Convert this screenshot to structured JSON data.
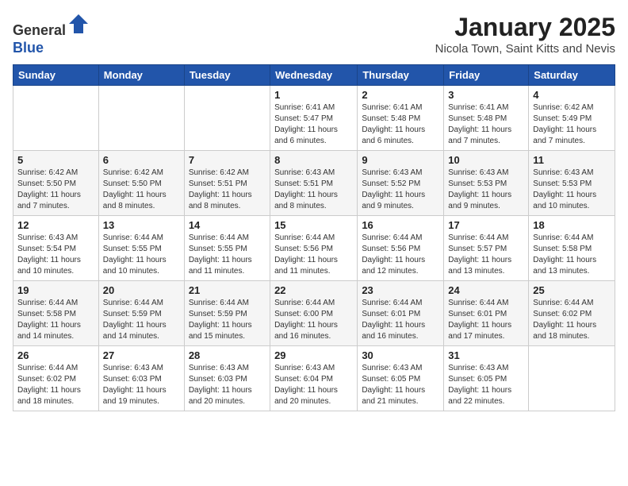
{
  "header": {
    "logo_line1": "General",
    "logo_line2": "Blue",
    "month": "January 2025",
    "location": "Nicola Town, Saint Kitts and Nevis"
  },
  "weekdays": [
    "Sunday",
    "Monday",
    "Tuesday",
    "Wednesday",
    "Thursday",
    "Friday",
    "Saturday"
  ],
  "weeks": [
    [
      {
        "day": "",
        "info": ""
      },
      {
        "day": "",
        "info": ""
      },
      {
        "day": "",
        "info": ""
      },
      {
        "day": "1",
        "info": "Sunrise: 6:41 AM\nSunset: 5:47 PM\nDaylight: 11 hours\nand 6 minutes."
      },
      {
        "day": "2",
        "info": "Sunrise: 6:41 AM\nSunset: 5:48 PM\nDaylight: 11 hours\nand 6 minutes."
      },
      {
        "day": "3",
        "info": "Sunrise: 6:41 AM\nSunset: 5:48 PM\nDaylight: 11 hours\nand 7 minutes."
      },
      {
        "day": "4",
        "info": "Sunrise: 6:42 AM\nSunset: 5:49 PM\nDaylight: 11 hours\nand 7 minutes."
      }
    ],
    [
      {
        "day": "5",
        "info": "Sunrise: 6:42 AM\nSunset: 5:50 PM\nDaylight: 11 hours\nand 7 minutes."
      },
      {
        "day": "6",
        "info": "Sunrise: 6:42 AM\nSunset: 5:50 PM\nDaylight: 11 hours\nand 8 minutes."
      },
      {
        "day": "7",
        "info": "Sunrise: 6:42 AM\nSunset: 5:51 PM\nDaylight: 11 hours\nand 8 minutes."
      },
      {
        "day": "8",
        "info": "Sunrise: 6:43 AM\nSunset: 5:51 PM\nDaylight: 11 hours\nand 8 minutes."
      },
      {
        "day": "9",
        "info": "Sunrise: 6:43 AM\nSunset: 5:52 PM\nDaylight: 11 hours\nand 9 minutes."
      },
      {
        "day": "10",
        "info": "Sunrise: 6:43 AM\nSunset: 5:53 PM\nDaylight: 11 hours\nand 9 minutes."
      },
      {
        "day": "11",
        "info": "Sunrise: 6:43 AM\nSunset: 5:53 PM\nDaylight: 11 hours\nand 10 minutes."
      }
    ],
    [
      {
        "day": "12",
        "info": "Sunrise: 6:43 AM\nSunset: 5:54 PM\nDaylight: 11 hours\nand 10 minutes."
      },
      {
        "day": "13",
        "info": "Sunrise: 6:44 AM\nSunset: 5:55 PM\nDaylight: 11 hours\nand 10 minutes."
      },
      {
        "day": "14",
        "info": "Sunrise: 6:44 AM\nSunset: 5:55 PM\nDaylight: 11 hours\nand 11 minutes."
      },
      {
        "day": "15",
        "info": "Sunrise: 6:44 AM\nSunset: 5:56 PM\nDaylight: 11 hours\nand 11 minutes."
      },
      {
        "day": "16",
        "info": "Sunrise: 6:44 AM\nSunset: 5:56 PM\nDaylight: 11 hours\nand 12 minutes."
      },
      {
        "day": "17",
        "info": "Sunrise: 6:44 AM\nSunset: 5:57 PM\nDaylight: 11 hours\nand 13 minutes."
      },
      {
        "day": "18",
        "info": "Sunrise: 6:44 AM\nSunset: 5:58 PM\nDaylight: 11 hours\nand 13 minutes."
      }
    ],
    [
      {
        "day": "19",
        "info": "Sunrise: 6:44 AM\nSunset: 5:58 PM\nDaylight: 11 hours\nand 14 minutes."
      },
      {
        "day": "20",
        "info": "Sunrise: 6:44 AM\nSunset: 5:59 PM\nDaylight: 11 hours\nand 14 minutes."
      },
      {
        "day": "21",
        "info": "Sunrise: 6:44 AM\nSunset: 5:59 PM\nDaylight: 11 hours\nand 15 minutes."
      },
      {
        "day": "22",
        "info": "Sunrise: 6:44 AM\nSunset: 6:00 PM\nDaylight: 11 hours\nand 16 minutes."
      },
      {
        "day": "23",
        "info": "Sunrise: 6:44 AM\nSunset: 6:01 PM\nDaylight: 11 hours\nand 16 minutes."
      },
      {
        "day": "24",
        "info": "Sunrise: 6:44 AM\nSunset: 6:01 PM\nDaylight: 11 hours\nand 17 minutes."
      },
      {
        "day": "25",
        "info": "Sunrise: 6:44 AM\nSunset: 6:02 PM\nDaylight: 11 hours\nand 18 minutes."
      }
    ],
    [
      {
        "day": "26",
        "info": "Sunrise: 6:44 AM\nSunset: 6:02 PM\nDaylight: 11 hours\nand 18 minutes."
      },
      {
        "day": "27",
        "info": "Sunrise: 6:43 AM\nSunset: 6:03 PM\nDaylight: 11 hours\nand 19 minutes."
      },
      {
        "day": "28",
        "info": "Sunrise: 6:43 AM\nSunset: 6:03 PM\nDaylight: 11 hours\nand 20 minutes."
      },
      {
        "day": "29",
        "info": "Sunrise: 6:43 AM\nSunset: 6:04 PM\nDaylight: 11 hours\nand 20 minutes."
      },
      {
        "day": "30",
        "info": "Sunrise: 6:43 AM\nSunset: 6:05 PM\nDaylight: 11 hours\nand 21 minutes."
      },
      {
        "day": "31",
        "info": "Sunrise: 6:43 AM\nSunset: 6:05 PM\nDaylight: 11 hours\nand 22 minutes."
      },
      {
        "day": "",
        "info": ""
      }
    ]
  ]
}
